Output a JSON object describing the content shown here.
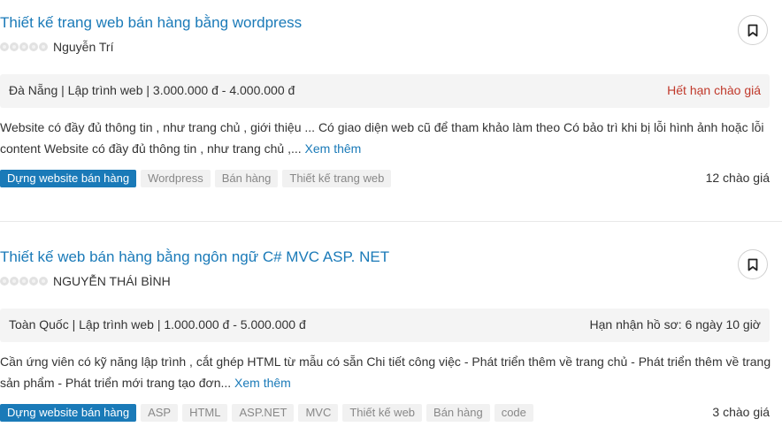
{
  "jobs": [
    {
      "title": "Thiết kế trang web bán hàng bằng wordpress",
      "author": "Nguyễn Trí",
      "info": "Đà Nẵng | Lập trình web | 3.000.000 đ - 4.000.000 đ",
      "status": "Hết hạn chào giá",
      "description": "Website có đầy đủ thông tin , như trang chủ , giới thiệu ... Có giao diện web cũ để tham khảo làm theo Có bảo trì khi bị lỗi hình ảnh hoặc lỗi content Website có đầy đủ thông tin , như trang chủ ,...",
      "more_label": "Xem thêm",
      "tags": [
        "Dựng website bán hàng",
        "Wordpress",
        "Bán hàng",
        "Thiết kế trang web"
      ],
      "bids": "12 chào giá"
    },
    {
      "title": "Thiết kế web bán hàng bằng ngôn ngữ C# MVC ASP. NET",
      "author": "NGUYỄN THÁI BÌNH",
      "info": "Toàn Quốc | Lập trình web | 1.000.000 đ - 5.000.000 đ",
      "status": "Hạn nhận hồ sơ: 6 ngày 10 giờ",
      "description": "Cần ứng viên có kỹ năng lập trình , cắt ghép HTML từ mẫu có sẵn Chi tiết công việc - Phát triển thêm về trang chủ - Phát triển thêm về trang sản phẩm - Phát triển mới trang tạo đơn...",
      "more_label": "Xem thêm",
      "tags": [
        "Dựng website bán hàng",
        "ASP",
        "HTML",
        "ASP.NET",
        "MVC",
        "Thiết kế web",
        "Bán hàng",
        "code"
      ],
      "bids": "3 chào giá"
    }
  ],
  "icons": {
    "bookmark": "bookmark-icon",
    "rating": "rating-star-icon"
  },
  "colors": {
    "link": "#1a7ab8",
    "expired": "#c0392b",
    "tag_primary": "#1a7ab8",
    "info_bg": "#f4f4f4"
  }
}
